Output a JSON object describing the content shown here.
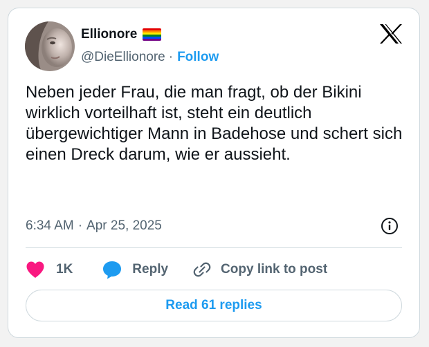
{
  "author": {
    "display_name": "Ellionore",
    "handle": "@DieEllionore",
    "separator": "·",
    "follow_label": "Follow",
    "badge_icon": "rainbow-flag-icon",
    "flag_colors": [
      "#e40303",
      "#ff8c00",
      "#ffed00",
      "#008026",
      "#004dff",
      "#750787"
    ]
  },
  "tweet": {
    "text": "Neben jeder Frau, die man fragt, ob der Bikini wirklich vorteilhaft ist, steht ein deutlich übergewichtiger Mann in Badehose und schert sich einen Dreck darum, wie er aussieht.",
    "time": "6:34 AM",
    "separator": "·",
    "date": "Apr 25, 2025"
  },
  "actions": {
    "like_count": "1K",
    "reply_label": "Reply",
    "copy_link_label": "Copy link to post"
  },
  "read_replies_label": "Read 61 replies",
  "colors": {
    "accent": "#1d9bf0",
    "like": "#f91880",
    "text_primary": "#0f1419",
    "text_secondary": "#536471",
    "border": "#cfd9de"
  },
  "icons": {
    "logo": "x-logo-icon",
    "info": "info-icon",
    "like": "heart-icon",
    "reply": "speech-bubble-icon",
    "copy_link": "link-icon"
  }
}
